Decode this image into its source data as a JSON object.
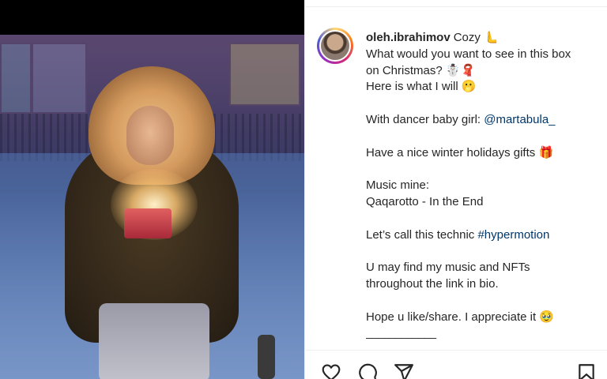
{
  "post": {
    "username": "oleh.ibrahimov",
    "caption_lines": [
      "Cozy 🫷",
      "What would you want to see in this box",
      "on Christmas? ☃️🧣",
      "Here is what I will 🫢",
      "",
      "With dancer baby girl: ",
      "",
      "Have a nice winter holidays gifts 🎁",
      "",
      "Music mine:",
      "Qaqarotto - In the End",
      "",
      "Let’s call this technic ",
      "",
      "U may find my music and NFTs",
      "throughout the link in bio.",
      "",
      "Hope u like/share. I appreciate it 🥹",
      "____________"
    ],
    "mention": "@martabula_",
    "hashtag": "#hypermotion"
  },
  "icons": {
    "like": "heart-icon",
    "comment": "comment-icon",
    "share": "paper-plane-icon",
    "save": "bookmark-icon"
  },
  "colors": {
    "link": "#00376b",
    "text": "#262626",
    "divider": "#efefef"
  }
}
